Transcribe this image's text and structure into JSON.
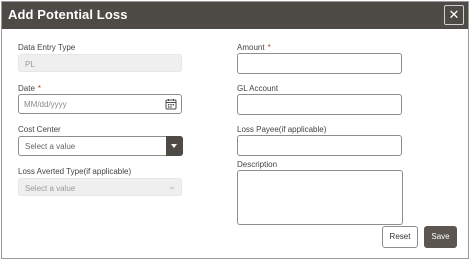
{
  "dialog": {
    "title": "Add Potential Loss",
    "close_icon": "close-icon"
  },
  "form": {
    "data_entry_type": {
      "label": "Data Entry Type",
      "value": "PL"
    },
    "date": {
      "label": "Date",
      "required_mark": "*",
      "placeholder": "MM/dd/yyyy",
      "icon": "calendar-icon"
    },
    "cost_center": {
      "label": "Cost Center",
      "value": "Select a value",
      "icon": "chevron-down-icon"
    },
    "loss_averted_type": {
      "label": "Loss Averted Type(if applicable)",
      "value": "Select a value"
    },
    "amount": {
      "label": "Amount",
      "required_mark": "*"
    },
    "gl_account": {
      "label": "GL Account"
    },
    "loss_payee": {
      "label": "Loss Payee(if applicable)"
    },
    "description": {
      "label": "Description"
    }
  },
  "buttons": {
    "reset_label": "Reset",
    "save_label": "Save"
  },
  "colors": {
    "title_bar": "#4e4a45",
    "required": "#c0392b",
    "save_button": "#5b5650"
  }
}
